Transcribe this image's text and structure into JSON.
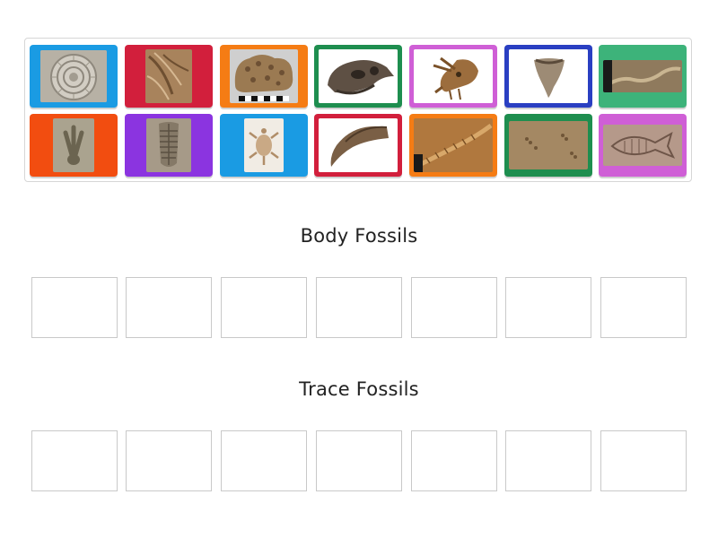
{
  "tiles": [
    {
      "icon": "ammonite-fossil-icon",
      "frame_color": "#1a9be3"
    },
    {
      "icon": "crinoid-fossil-icon",
      "frame_color": "#d21f3c"
    },
    {
      "icon": "coral-fossil-icon",
      "frame_color": "#f57c14"
    },
    {
      "icon": "dinosaur-skull-fossil-icon",
      "frame_color": "#1e8e4f"
    },
    {
      "icon": "triceratops-skull-fossil-icon",
      "frame_color": "#cf5fd6"
    },
    {
      "icon": "shark-tooth-fossil-icon",
      "frame_color": "#2a3fc2"
    },
    {
      "icon": "worm-trail-fossil-icon",
      "frame_color": "#3db37a"
    },
    {
      "icon": "dinosaur-footprint-fossil-icon",
      "frame_color": "#f24d10"
    },
    {
      "icon": "trilobite-fossil-icon",
      "frame_color": "#8b34e0"
    },
    {
      "icon": "turtle-fossil-icon",
      "frame_color": "#1a9be3"
    },
    {
      "icon": "claw-fossil-icon",
      "frame_color": "#d21f3c"
    },
    {
      "icon": "burrow-trace-fossil-icon",
      "frame_color": "#f57c14"
    },
    {
      "icon": "tracks-trace-fossil-icon",
      "frame_color": "#1e8e4f"
    },
    {
      "icon": "fish-fossil-icon",
      "frame_color": "#cf5fd6"
    }
  ],
  "groups": [
    {
      "title": "Body Fossils",
      "slot_count": 7
    },
    {
      "title": "Trace Fossils",
      "slot_count": 7
    }
  ]
}
